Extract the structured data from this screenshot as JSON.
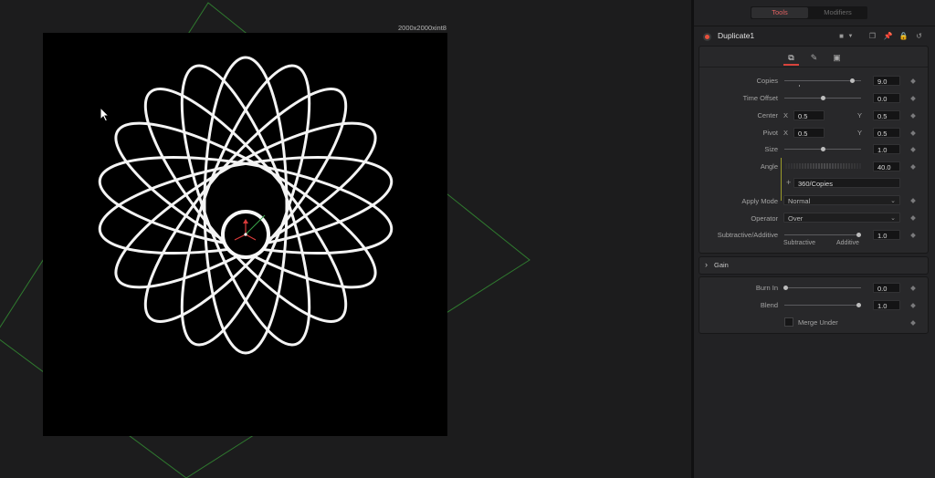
{
  "viewer": {
    "resolution_label": "2000x2000xint8"
  },
  "inspector": {
    "tabs": {
      "tools": "Tools",
      "modifiers": "Modifiers"
    },
    "node_name": "Duplicate1",
    "header_icons": [
      "version-icon",
      "window-icon",
      "pin-icon",
      "lock-icon",
      "reset-icon"
    ],
    "params": {
      "copies": {
        "label": "Copies",
        "value": "9.0",
        "slider_fraction": 0.92
      },
      "time_offset": {
        "label": "Time Offset",
        "value": "0.0",
        "slider_fraction": 0.5
      },
      "center": {
        "label": "Center",
        "x_label": "X",
        "x": "0.5",
        "y_label": "Y",
        "y": "0.5"
      },
      "pivot": {
        "label": "Pivot",
        "x_label": "X",
        "x": "0.5",
        "y_label": "Y",
        "y": "0.5"
      },
      "size": {
        "label": "Size",
        "value": "1.0",
        "slider_fraction": 0.5
      },
      "angle": {
        "label": "Angle",
        "value": "40.0",
        "expression": "360/Copies"
      },
      "apply_mode": {
        "label": "Apply Mode",
        "value": "Normal"
      },
      "operator": {
        "label": "Operator",
        "value": "Over"
      },
      "sub_add": {
        "label": "Subtractive/Additive",
        "value": "1.0",
        "slider_fraction": 1.0,
        "left_label": "Subtractive",
        "right_label": "Additive"
      }
    },
    "gain": {
      "header": "Gain",
      "burn_in": {
        "label": "Burn In",
        "value": "0.0",
        "slider_fraction": 0.0
      },
      "blend": {
        "label": "Blend",
        "value": "1.0",
        "slider_fraction": 1.0
      },
      "merge_under": {
        "label": "Merge Under",
        "checked": false
      }
    }
  }
}
